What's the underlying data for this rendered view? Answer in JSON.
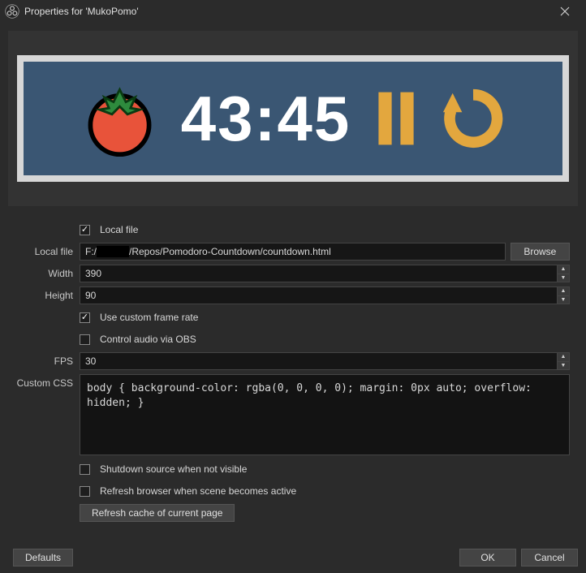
{
  "window": {
    "title": "Properties for 'MukoPomo'"
  },
  "preview": {
    "timer": "43:45"
  },
  "form": {
    "local_file_checkbox_label": "Local file",
    "local_file_checked": true,
    "local_file_label": "Local file",
    "local_file_prefix": "F:/",
    "local_file_suffix": "/Repos/Pomodoro-Countdown/countdown.html",
    "browse_label": "Browse",
    "width_label": "Width",
    "width_value": "390",
    "height_label": "Height",
    "height_value": "90",
    "use_custom_frame_rate_label": "Use custom frame rate",
    "use_custom_frame_rate_checked": true,
    "control_audio_label": "Control audio via OBS",
    "control_audio_checked": false,
    "fps_label": "FPS",
    "fps_value": "30",
    "custom_css_label": "Custom CSS",
    "custom_css_value": "body { background-color: rgba(0, 0, 0, 0); margin: 0px auto; overflow: hidden; }",
    "shutdown_label": "Shutdown source when not visible",
    "shutdown_checked": false,
    "refresh_browser_label": "Refresh browser when scene becomes active",
    "refresh_browser_checked": false,
    "refresh_cache_button": "Refresh cache of current page"
  },
  "footer": {
    "defaults": "Defaults",
    "ok": "OK",
    "cancel": "Cancel"
  }
}
